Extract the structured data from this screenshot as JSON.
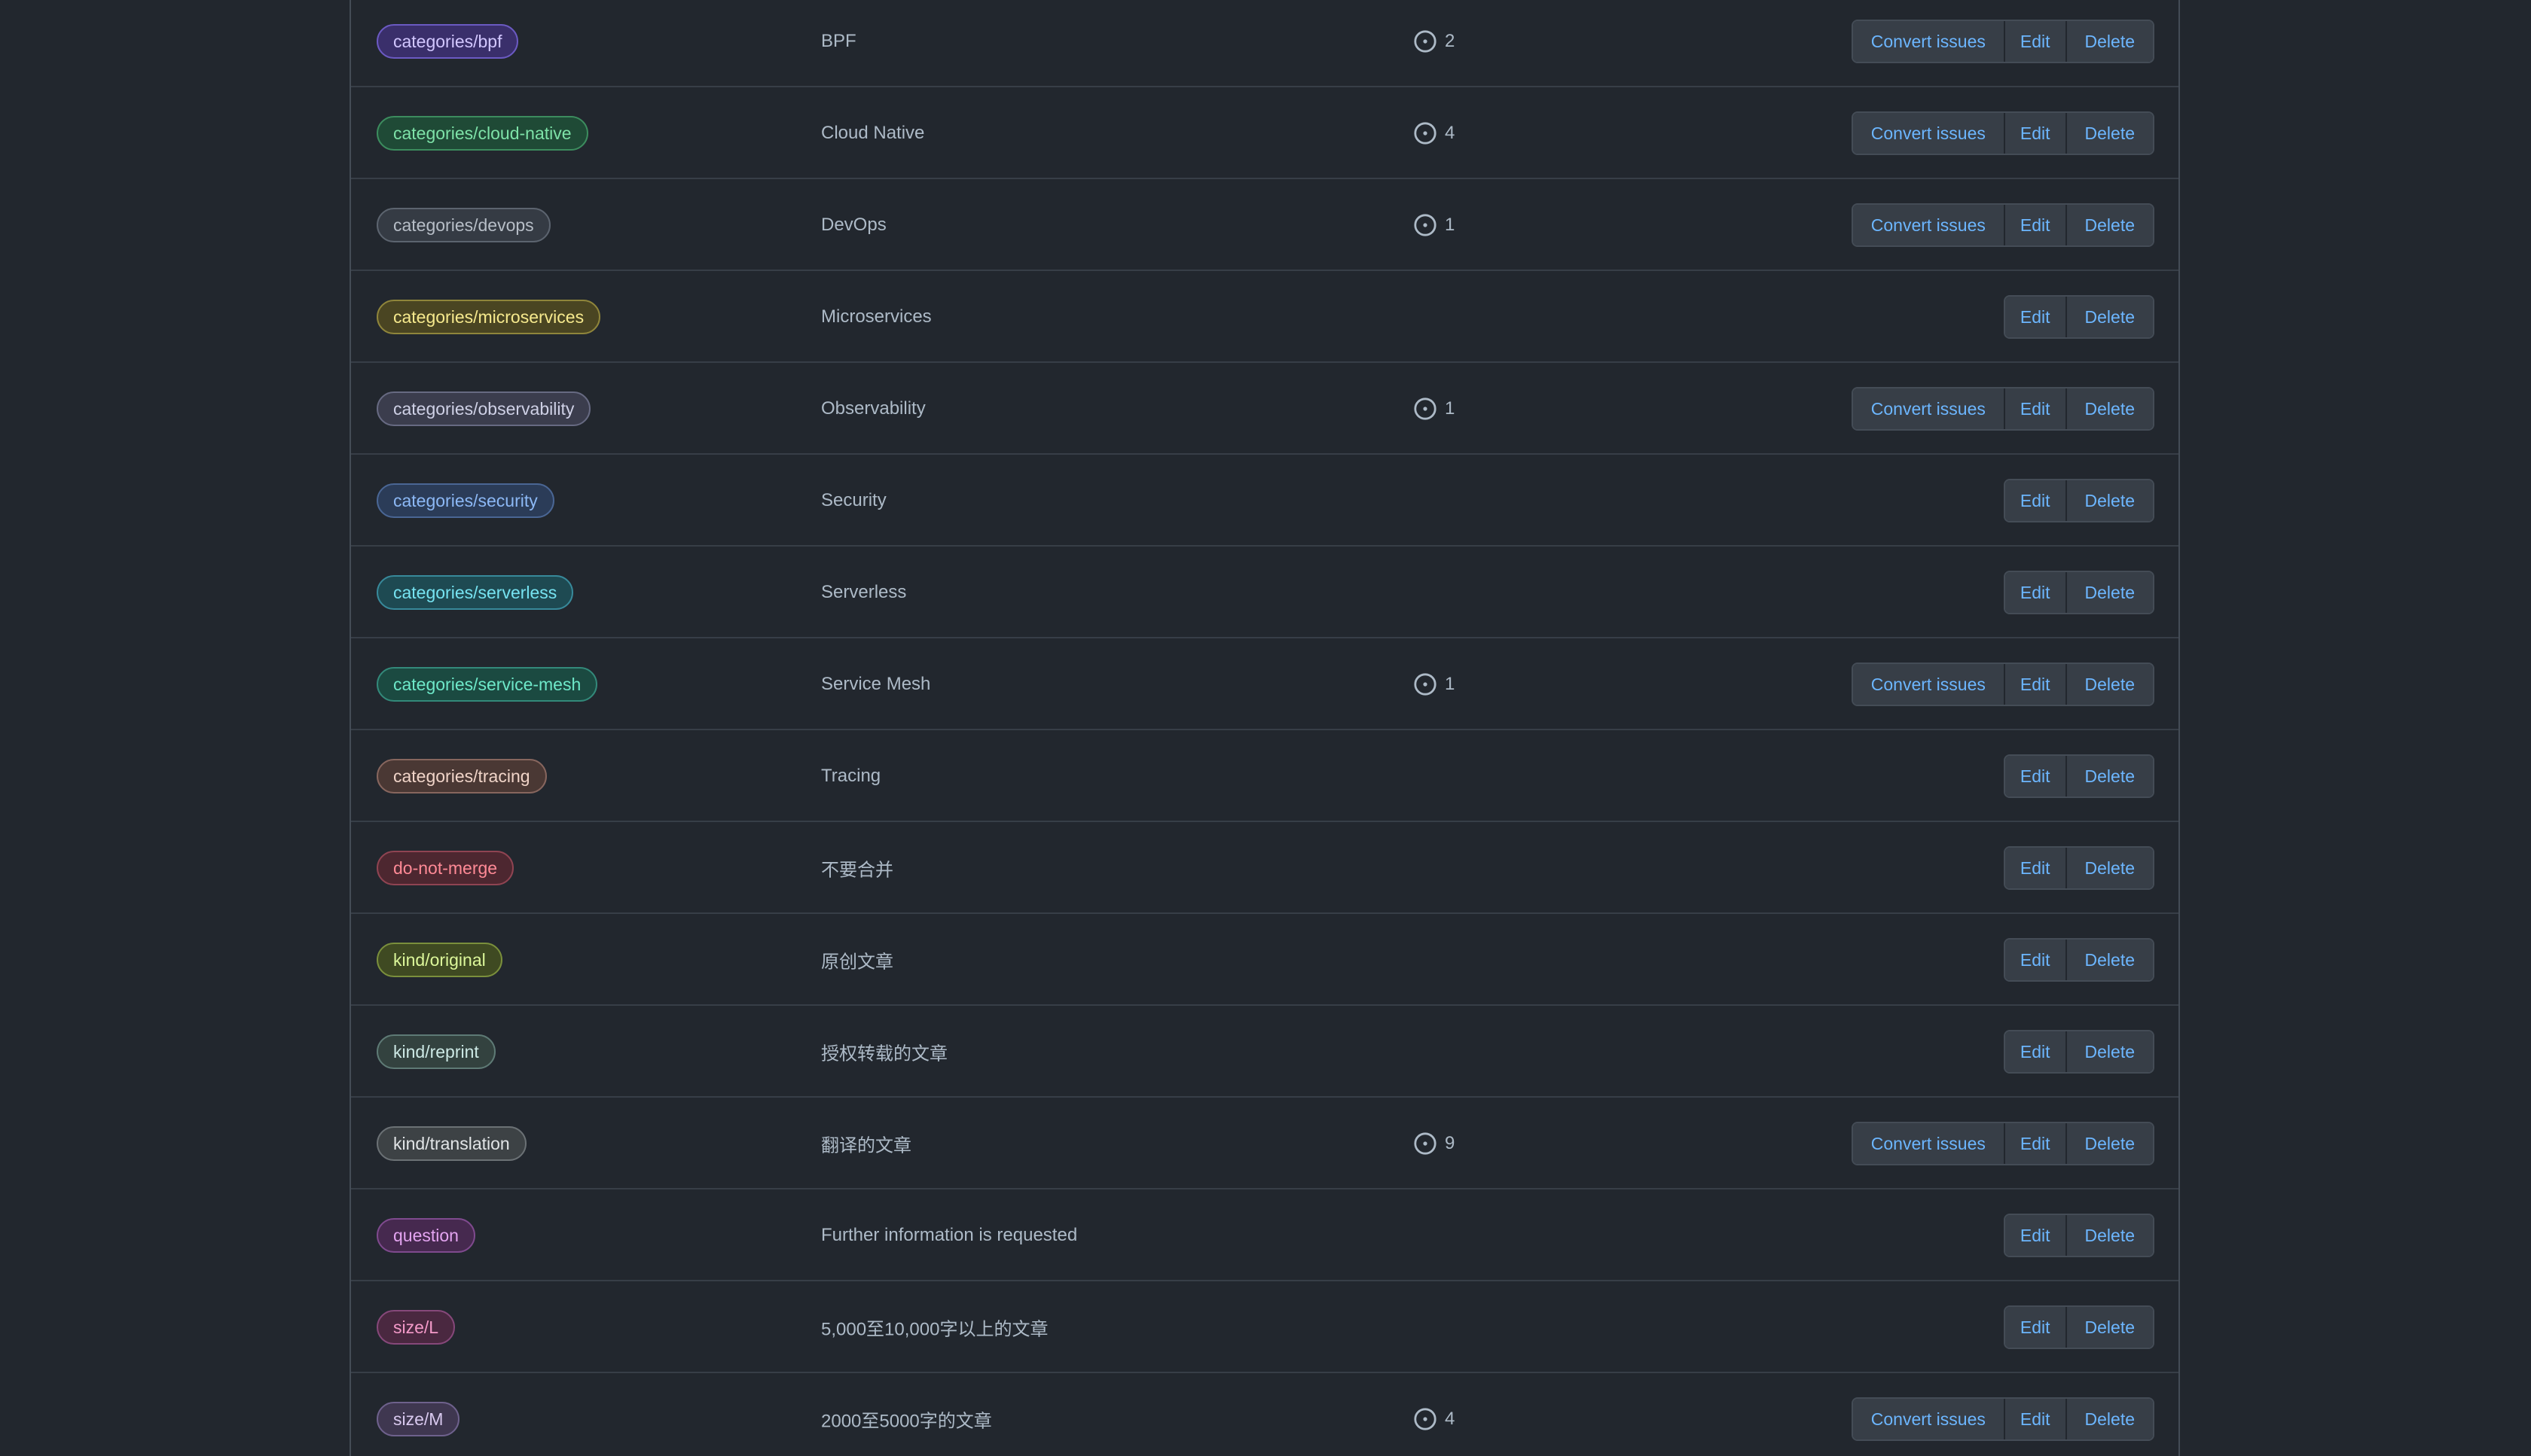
{
  "actions": {
    "convert_label": "Convert issues",
    "edit_label": "Edit",
    "delete_label": "Delete"
  },
  "labels": [
    {
      "name": "categories/bpf",
      "description": "BPF",
      "issues": "2",
      "has_convert": true,
      "text_color": "#d2c7ff",
      "bg_color": "#3a2f6b",
      "border_color": "#6b5ac2"
    },
    {
      "name": "categories/cloud-native",
      "description": "Cloud Native",
      "issues": "4",
      "has_convert": true,
      "text_color": "#7ee2a8",
      "bg_color": "#1f4a36",
      "border_color": "#3c8c5e"
    },
    {
      "name": "categories/devops",
      "description": "DevOps",
      "issues": "1",
      "has_convert": true,
      "text_color": "#b7bec7",
      "bg_color": "#353b44",
      "border_color": "#5c646f"
    },
    {
      "name": "categories/microservices",
      "description": "Microservices",
      "issues": "",
      "has_convert": false,
      "text_color": "#f6e98d",
      "bg_color": "#4a4522",
      "border_color": "#8f853b"
    },
    {
      "name": "categories/observability",
      "description": "Observability",
      "issues": "1",
      "has_convert": true,
      "text_color": "#cfd1e6",
      "bg_color": "#3b3d4d",
      "border_color": "#676a82"
    },
    {
      "name": "categories/security",
      "description": "Security",
      "issues": "",
      "has_convert": false,
      "text_color": "#8cb8f5",
      "bg_color": "#2b3c58",
      "border_color": "#4a6694"
    },
    {
      "name": "categories/serverless",
      "description": "Serverless",
      "issues": "",
      "has_convert": false,
      "text_color": "#76e3f1",
      "bg_color": "#1e4a52",
      "border_color": "#38899a"
    },
    {
      "name": "categories/service-mesh",
      "description": "Service Mesh",
      "issues": "1",
      "has_convert": true,
      "text_color": "#6ee8c9",
      "bg_color": "#1b4a41",
      "border_color": "#33897a"
    },
    {
      "name": "categories/tracing",
      "description": "Tracing",
      "issues": "",
      "has_convert": false,
      "text_color": "#f0d4c8",
      "bg_color": "#4a3834",
      "border_color": "#87665e"
    },
    {
      "name": "do-not-merge",
      "description": "不要合并",
      "issues": "",
      "has_convert": false,
      "text_color": "#ff8a96",
      "bg_color": "#4d2730",
      "border_color": "#8f4452"
    },
    {
      "name": "kind/original",
      "description": "原创文章",
      "issues": "",
      "has_convert": false,
      "text_color": "#dcf79a",
      "bg_color": "#3f4a22",
      "border_color": "#7a8f3c"
    },
    {
      "name": "kind/reprint",
      "description": "授权转载的文章",
      "issues": "",
      "has_convert": false,
      "text_color": "#cde9e5",
      "bg_color": "#33423f",
      "border_color": "#5e7a75"
    },
    {
      "name": "kind/translation",
      "description": "翻译的文章",
      "issues": "9",
      "has_convert": true,
      "text_color": "#e2e5e7",
      "bg_color": "#3d4245",
      "border_color": "#6b7175"
    },
    {
      "name": "question",
      "description": "Further information is requested",
      "issues": "",
      "has_convert": false,
      "text_color": "#e3a4f0",
      "bg_color": "#46294f",
      "border_color": "#7f4a8e"
    },
    {
      "name": "size/L",
      "description": "5,000至10,000字以上的文章",
      "issues": "",
      "has_convert": false,
      "text_color": "#f49ac9",
      "bg_color": "#4a2840",
      "border_color": "#86487a"
    },
    {
      "name": "size/M",
      "description": "2000至5000字的文章",
      "issues": "4",
      "has_convert": true,
      "text_color": "#d9c9ef",
      "bg_color": "#3f3750",
      "border_color": "#6e618c"
    }
  ]
}
